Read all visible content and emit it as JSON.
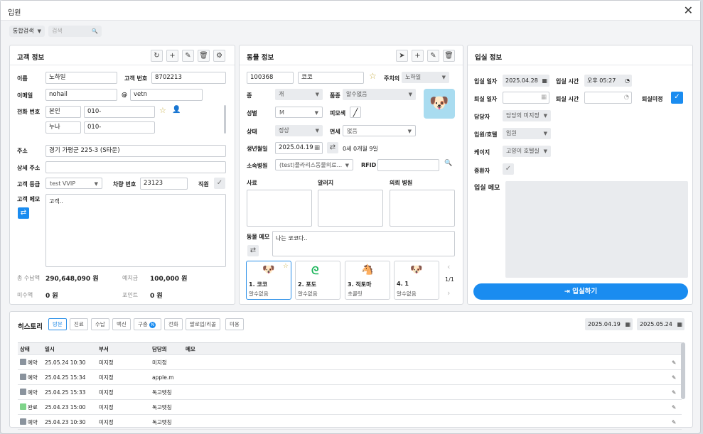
{
  "window": {
    "title": "입원",
    "close": "✕"
  },
  "search": {
    "mode": "통합검색",
    "placeholder": "검색"
  },
  "customer": {
    "title": "고객 정보",
    "name_label": "이름",
    "name": "노하일",
    "no_label": "고객 번호",
    "no": "8702213",
    "email_label": "이메일",
    "email_user": "nohail",
    "at": "@",
    "email_domain": "vetn",
    "phone_label": "전화 번호",
    "phones": [
      {
        "rel": "본인",
        "num": "010-"
      },
      {
        "rel": "누나",
        "num": "010-"
      }
    ],
    "addr_label": "주소",
    "addr": "경기 가평군                225-3 (S타운)",
    "addr2_label": "상세 주소",
    "grade_label": "고객 등급",
    "grade": "test VVIP",
    "car_label": "차량 번호",
    "car": "23123",
    "staff_label": "직원",
    "memo_label": "고객 메모",
    "memo": "고객..",
    "paid_label": "총 수납액",
    "paid": "290,648,090 원",
    "deposit_label": "예치금",
    "deposit": "100,000 원",
    "unpaid_label": "미수액",
    "unpaid": "0 원",
    "point_label": "포인트",
    "point": "0 원"
  },
  "pet": {
    "title": "동물 정보",
    "id": "100368",
    "name": "코코",
    "vet_label": "주치의",
    "vet": "노하일",
    "species_label": "종",
    "species": "개",
    "breed_label": "품종",
    "breed": "알수없음",
    "sex_label": "성별",
    "sex": "M",
    "coat_label": "피모색",
    "status_label": "상태",
    "status": "정상",
    "neuter_label": "면세",
    "neuter": "없음",
    "birth_label": "생년월일",
    "birth": "2025.04.19",
    "age": "0세 0개월 9일",
    "hospital_label": "소속병원",
    "hospital": "(test)플라리스동물의료...",
    "rfid_label": "RFID",
    "history_label": "사료",
    "allergy_label": "알러지",
    "referral_label": "의뢰 병원",
    "memo_label": "동물 메모",
    "memo": "나는 코코다..",
    "pages": "1/1",
    "cards": [
      {
        "name": "1. 코코",
        "breed": "알수없음"
      },
      {
        "name": "2. 포도",
        "breed": "알수없음"
      },
      {
        "name": "3. 적토마",
        "breed": "초콜릿"
      },
      {
        "name": "4. 1",
        "breed": "알수없음"
      }
    ]
  },
  "admit": {
    "title": "입실 정보",
    "in_date_label": "입실 일자",
    "in_date": "2025.04.28",
    "in_time_label": "입실 시간",
    "in_time": "오후 05:27",
    "out_date_label": "퇴실 일자",
    "out_time_label": "퇴실 시간",
    "undecided_label": "퇴실미정",
    "doctor_label": "담당자",
    "doctor": "담당의 미지정",
    "ward_label": "입원/호텔",
    "ward": "입원",
    "cage_label": "케이지",
    "cage": "고양이 호텔실",
    "critical_label": "중환자",
    "memo_label": "입실 메모",
    "submit": "입실하기"
  },
  "history": {
    "title": "히스토리",
    "tabs": [
      "방문",
      "진료",
      "수납",
      "백신",
      "구충",
      "전화",
      "팔로업/리콜",
      "미용"
    ],
    "badge": "N",
    "from": "2025.04.19",
    "to": "2025.05.24",
    "columns": [
      "상태",
      "일시",
      "부서",
      "담당의",
      "메모"
    ],
    "rows": [
      {
        "status": "예약",
        "color": "#8a939d",
        "date": "25.05.24 10:30",
        "dept": "미지정",
        "doctor": "미지정"
      },
      {
        "status": "예약",
        "color": "#8a939d",
        "date": "25.04.25 15:34",
        "dept": "미지정",
        "doctor": "apple.m"
      },
      {
        "status": "예약",
        "color": "#8a939d",
        "date": "25.04.25 15:33",
        "dept": "미지정",
        "doctor": "독고벳칭"
      },
      {
        "status": "완료",
        "color": "#7fd48a",
        "date": "25.04.23 15:00",
        "dept": "미지정",
        "doctor": "독고벳칭"
      },
      {
        "status": "예약",
        "color": "#8a939d",
        "date": "25.04.23 10:30",
        "dept": "미지정",
        "doctor": "독고벳칭"
      }
    ]
  },
  "colors": {
    "accent": "#1a8cf0"
  }
}
